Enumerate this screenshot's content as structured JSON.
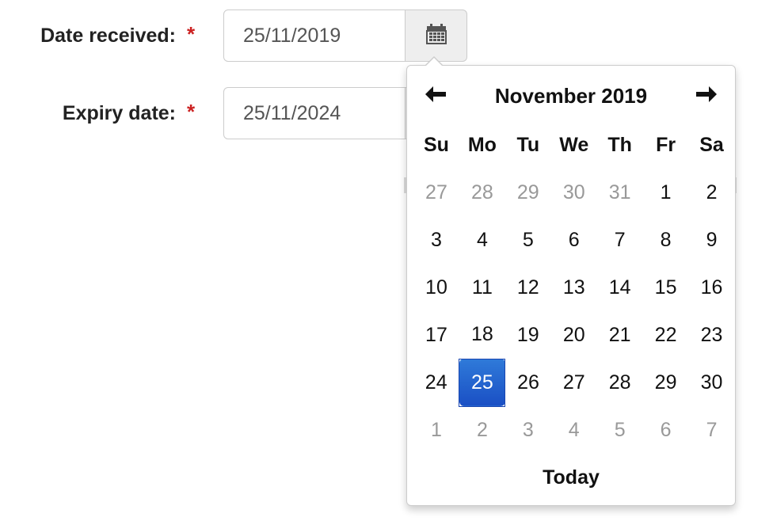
{
  "form": {
    "date_received": {
      "label": "Date received:",
      "required_mark": "*",
      "value": "25/11/2019"
    },
    "expiry_date": {
      "label": "Expiry date:",
      "required_mark": "*",
      "value": "25/11/2024"
    },
    "calendar_button_icon": "calendar-icon"
  },
  "datepicker": {
    "month_title": "November 2019",
    "prev_icon": "arrow-left-icon",
    "next_icon": "arrow-right-icon",
    "weekdays": [
      "Su",
      "Mo",
      "Tu",
      "We",
      "Th",
      "Fr",
      "Sa"
    ],
    "weeks": [
      [
        {
          "d": "27",
          "muted": true
        },
        {
          "d": "28",
          "muted": true
        },
        {
          "d": "29",
          "muted": true
        },
        {
          "d": "30",
          "muted": true
        },
        {
          "d": "31",
          "muted": true
        },
        {
          "d": "1"
        },
        {
          "d": "2"
        }
      ],
      [
        {
          "d": "3"
        },
        {
          "d": "4"
        },
        {
          "d": "5"
        },
        {
          "d": "6"
        },
        {
          "d": "7"
        },
        {
          "d": "8"
        },
        {
          "d": "9"
        }
      ],
      [
        {
          "d": "10"
        },
        {
          "d": "11"
        },
        {
          "d": "12"
        },
        {
          "d": "13"
        },
        {
          "d": "14"
        },
        {
          "d": "15"
        },
        {
          "d": "16"
        }
      ],
      [
        {
          "d": "17"
        },
        {
          "d": "18"
        },
        {
          "d": "19"
        },
        {
          "d": "20"
        },
        {
          "d": "21"
        },
        {
          "d": "22"
        },
        {
          "d": "23"
        }
      ],
      [
        {
          "d": "24"
        },
        {
          "d": "25",
          "active": true
        },
        {
          "d": "26"
        },
        {
          "d": "27"
        },
        {
          "d": "28"
        },
        {
          "d": "29"
        },
        {
          "d": "30"
        }
      ],
      [
        {
          "d": "1",
          "muted": true
        },
        {
          "d": "2",
          "muted": true
        },
        {
          "d": "3",
          "muted": true
        },
        {
          "d": "4",
          "muted": true
        },
        {
          "d": "5",
          "muted": true
        },
        {
          "d": "6",
          "muted": true
        },
        {
          "d": "7",
          "muted": true
        }
      ]
    ],
    "today_label": "Today",
    "colors": {
      "active_bg": "#1a4fc4",
      "muted_text": "#999999",
      "required": "#cc2222"
    }
  }
}
